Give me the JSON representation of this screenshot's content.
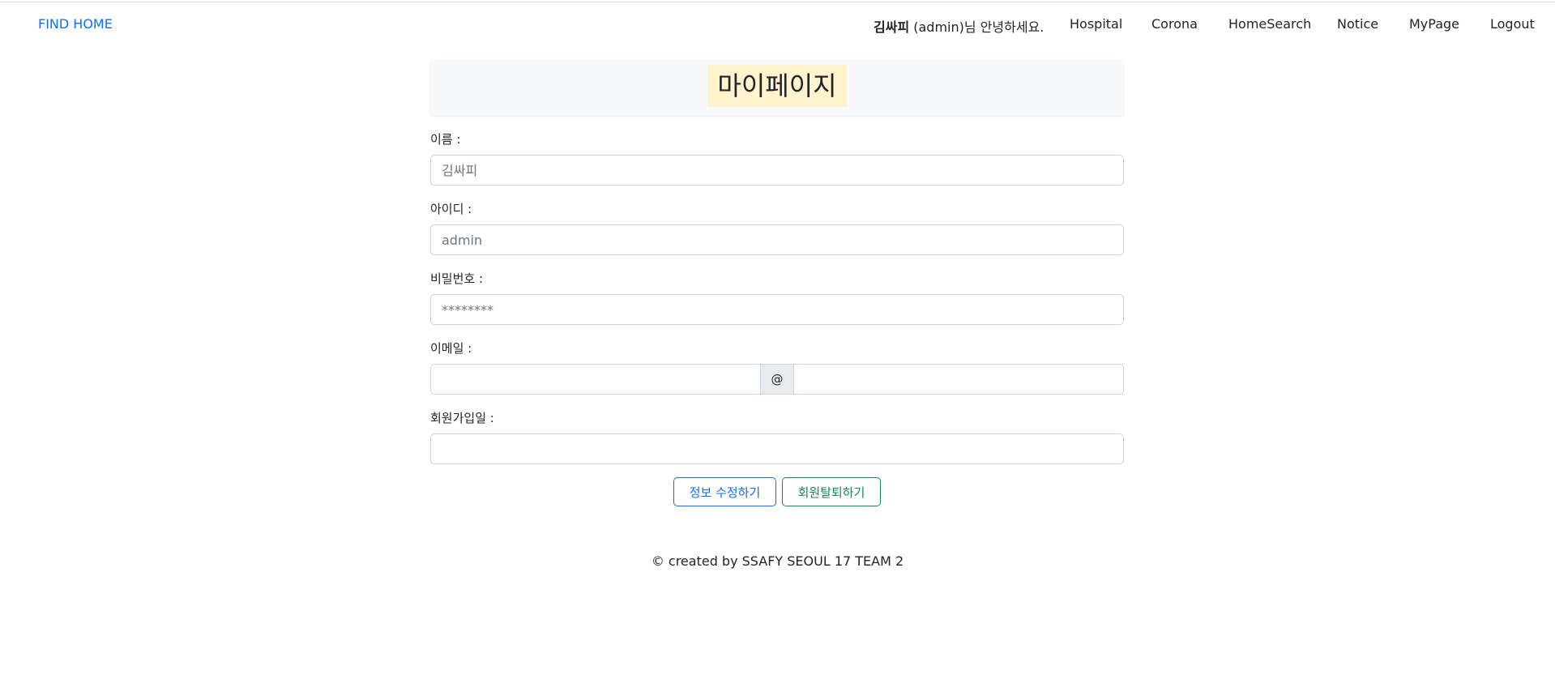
{
  "navbar": {
    "brand": "FIND HOME",
    "greeting_name": "김싸피",
    "greeting_rest": " (admin)님 안녕하세요.",
    "links": [
      "Hospital",
      "Corona",
      "HomeSearch",
      "Notice",
      "MyPage",
      "Logout"
    ]
  },
  "page": {
    "title": "마이페이지"
  },
  "form": {
    "name_label": "이름 :",
    "name_placeholder": "김싸피",
    "id_label": "아이디 :",
    "id_placeholder": "admin",
    "password_label": "비밀번호 :",
    "password_placeholder": "********",
    "email_label": "이메일 :",
    "email_at": "@",
    "email_local_value": "",
    "email_domain_value": "",
    "join_date_label": "회원가입일 :",
    "join_date_value": ""
  },
  "buttons": {
    "edit": "정보 수정하기",
    "withdraw": "회원탈퇴하기"
  },
  "footer": {
    "text": "© created by SSAFY SEOUL 17 TEAM 2"
  },
  "colors": {
    "brand": "#0d6efd",
    "title_highlight": "#fff3cd",
    "edit_button": "#0d6efd",
    "withdraw_button": "#198754"
  }
}
